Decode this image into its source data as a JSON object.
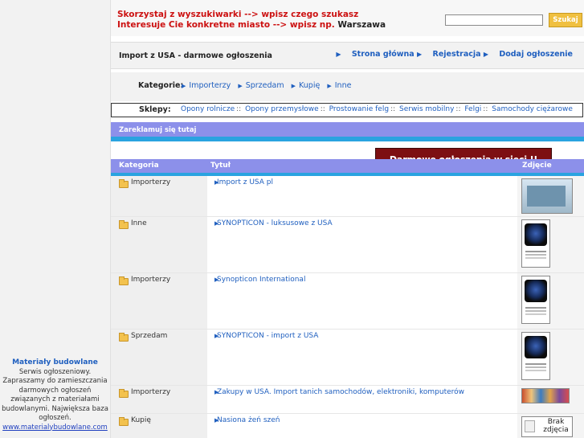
{
  "left": {
    "title": "Materiały budowlane",
    "desc": "Serwis ogłoszeniowy. Zapraszamy do zamieszczania darmowych ogłoszeń związanych z materiałami budowlanymi. Największa baza ogłoszeń.",
    "url": "www.materialybudowlane.com"
  },
  "header": {
    "ad_line1_part1": "Skorzystaj z wyszukiwarki --> ",
    "ad_line1_part2": "wpisz czego szukasz",
    "ad_line2_part1": "Interesuje Cie konkretne miasto --> ",
    "ad_line2_part2": "wpisz np. ",
    "ad_line2_part3": "Warszawa",
    "search_value": "",
    "search_button": "Szukaj"
  },
  "titlebar": {
    "title": "Import z USA - darmowe ogłoszenia",
    "nav": [
      "Strona główna",
      "Rejestracja",
      "Dodaj ogłoszenie"
    ]
  },
  "categories": {
    "label": "Kategorie:",
    "items": [
      "Importerzy",
      "Sprzedam",
      "Kupię",
      "Inne"
    ]
  },
  "ad_banner": "Darmowe ogłoszenia w sieci !!",
  "shops": {
    "label": "Sklepy:",
    "items": [
      "Opony rolnicze",
      "Opony przemysłowe",
      "Prostowanie felg",
      "Serwis mobilny",
      "Felgi",
      "Samochody ciężarowe"
    ]
  },
  "promo": "Zareklamuj się tutaj",
  "table": {
    "headers": [
      "Kategoria",
      "Tytuł",
      "Zdjęcie"
    ],
    "rows": [
      {
        "category": "Importerzy",
        "title": "Import z USA pl",
        "thumb": "website-screenshot"
      },
      {
        "category": "Inne",
        "title": "SYNOPTICON - luksusowe z USA",
        "thumb": "car-photo"
      },
      {
        "category": "Importerzy",
        "title": "Synopticon International",
        "thumb": "car-photo"
      },
      {
        "category": "Sprzedam",
        "title": "SYNOPTICON - import z USA",
        "thumb": "car-photo"
      },
      {
        "category": "Importerzy",
        "title": "Zakupy w USA. Import tanich samochodów, elektroniki, komputerów",
        "thumb": "banner-strip"
      },
      {
        "category": "Kupię",
        "title": "Nasiona żeń szeń",
        "thumb": "no-image",
        "thumb_text": "Brak zdjęcia"
      }
    ]
  }
}
